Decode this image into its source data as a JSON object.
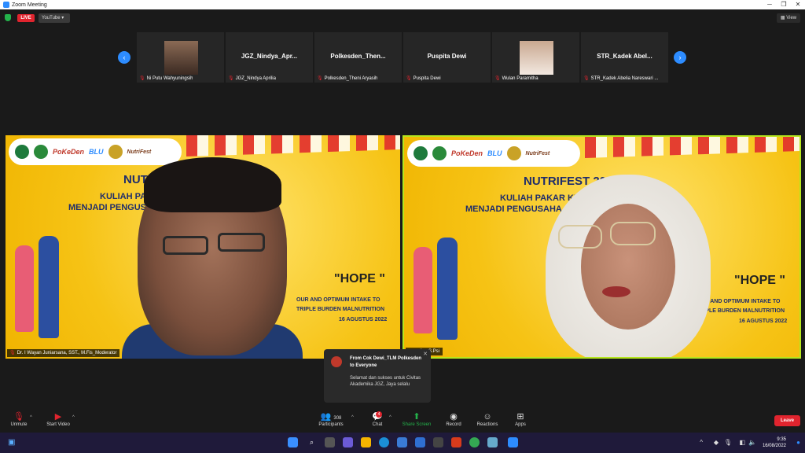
{
  "window": {
    "title": "Zoom Meeting"
  },
  "topbar": {
    "live_label": "LIVE",
    "stream_target": "YouTube ▾",
    "view_label": "View"
  },
  "strip": {
    "tiles": [
      {
        "name": "",
        "caption": "Ni Putu Wahyuningsih",
        "has_photo": true
      },
      {
        "name": "JGZ_Nindya_Apr...",
        "caption": "JGZ_Nindya Aprilia"
      },
      {
        "name": "Polkesden_Then...",
        "caption": "Polkesden_Theni Aryasih"
      },
      {
        "name": "Puspita Dewi",
        "caption": "Puspita Dewi"
      },
      {
        "name": "",
        "caption": "Wulan Paramitha",
        "has_photo": true
      },
      {
        "name": "STR_Kadek Abel...",
        "caption": "STR_Kadek Abelia Nareswari ..."
      }
    ]
  },
  "banner": {
    "logo_text_1": "PoKeDen",
    "logo_text_2": "BLU",
    "logo_text_3": "NutriFest",
    "title": "NUTRIFEST 2022",
    "line1": "KULIAH PAKAR KEWIRAUSAHAAN",
    "line2": "MENJADI PENGUSAHA SUKSES DI BIDANG GIZI",
    "hope": "\"HOPE \"",
    "sub1": "OUR AND OPTIMUM INTAKE TO",
    "sub2": "TRIPLE BURDEN MALNUTRITION",
    "date": "16 AGUSTUS 2022"
  },
  "videos": {
    "left_label": "Dr. I Wayan Juniarsana, SST., M.Fis_Moderator",
    "right_label": "...gustina,S.Psi"
  },
  "chat_popup": {
    "from": "From Cok Dewi_TLM Polkesden to Everyone",
    "message": "Selamat dan sukses untuk Civitas Akademika JGZ, Jaya selalu"
  },
  "toolbar": {
    "unmute": "Unmute",
    "start_video": "Start Video",
    "participants": "Participants",
    "participants_count": "308",
    "chat": "Chat",
    "chat_badge": "4",
    "share_screen": "Share Screen",
    "record": "Record",
    "reactions": "Reactions",
    "apps": "Apps",
    "leave": "Leave"
  },
  "taskbar": {
    "time": "9:35",
    "date": "16/08/2022"
  },
  "colors": {
    "accent": "#2d8cff",
    "danger": "#e0242e",
    "share": "#24b24b",
    "active_border": "#b5e61d"
  }
}
